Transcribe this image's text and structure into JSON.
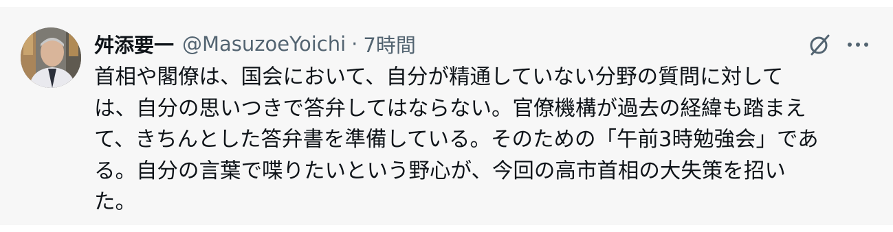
{
  "post": {
    "author_name": "舛添要一",
    "handle": "@MasuzoeYoichi",
    "separator": "·",
    "time": "7時間",
    "text": "首相や閣僚は、国会において、自分が精通していない分野の質問に対して\nは、自分の思いつきで答弁してはならない。官僚機構が過去の経緯も踏まえ\nて、きちんとした答弁書を準備している。そのための「午前3時勉強会」であ\nる。自分の言葉で喋りたいという野心が、今回の高市首相の大失策を招い\nた。"
  },
  "icons": {
    "grok": "grok-icon",
    "more": "more-icon"
  },
  "colors": {
    "card_background": "#f7f7f7",
    "text_primary": "#0f1419",
    "text_secondary": "#536471"
  }
}
